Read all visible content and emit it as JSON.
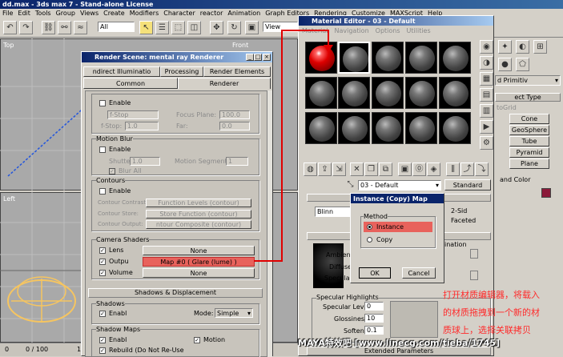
{
  "app": {
    "title": "dd.max - 3ds max 7 - Stand-alone License"
  },
  "menu": [
    "File",
    "Edit",
    "Tools",
    "Group",
    "Views",
    "Create",
    "Modifiers",
    "Character",
    "reactor",
    "Animation",
    "Graph Editors",
    "Rendering",
    "Customize",
    "MAXScript",
    "Help"
  ],
  "toolbar": {
    "selection_filter": "All",
    "ref_coord": "View"
  },
  "viewports": {
    "top": "Top",
    "front": "Front",
    "left": "Left"
  },
  "timeline": {
    "frame": "0 / 100",
    "ticks": [
      "0",
      "10"
    ]
  },
  "command_panel": {
    "category": "d Primitiv",
    "rollup_object_type": "ect Type",
    "autogrid": "toGrid",
    "buttons": [
      "Cone",
      "GeoSphere",
      "Tube",
      "Pyramid",
      "Plane"
    ],
    "name_color": "and Color"
  },
  "render_scene": {
    "title": "Render Scene: mental ray Renderer",
    "tabs_row1": [
      "ndirect Illuminatio",
      "Processing",
      "Render Elements"
    ],
    "tabs_row2": [
      "Common",
      "Renderer"
    ],
    "dof": {
      "enable": "Enable",
      "type": "f-Stop",
      "fstop_label": "f-Stop:",
      "fstop_value": "1.0",
      "focus_label": "Focus Plane:",
      "focus_value": "100.0",
      "far_label": "Far:",
      "far_value": "0.0"
    },
    "motion_blur": {
      "title": "Motion Blur",
      "enable": "Enable",
      "shutter_label": "Shutter:",
      "shutter_value": "1.0",
      "segments_label": "Motion Segments:",
      "segments_value": "1",
      "blur_all": "Blur All"
    },
    "contours": {
      "title": "Contours",
      "enable": "Enable",
      "contrast_label": "Contour Contrast:",
      "contrast_value": "Function Levels (contour)",
      "store_label": "Contour Store:",
      "store_value": "Store Function (contour)",
      "output_label": "Contour Output:",
      "output_value": "ntour Composite (contour)"
    },
    "camera_shaders": {
      "title": "Camera Shaders",
      "lens": "Lens",
      "output": "Outpu",
      "volume": "Volume",
      "lens_value": "None",
      "output_value": "Map #0   ( Glare (lume) )",
      "volume_value": "None"
    },
    "shadows_rollup": "Shadows & Displacement",
    "shadows": {
      "title": "Shadows",
      "enable": "Enabl",
      "mode_label": "Mode:",
      "mode_value": "Simple"
    },
    "shadow_maps": {
      "title": "Shadow Maps",
      "enable": "Enabl",
      "motion": "Motion",
      "rebuild": "Rebuild (Do Not Re-Use"
    }
  },
  "material_editor": {
    "title": "Material Editor - 03 - Default",
    "menu": [
      "Material",
      "Navigation",
      "Options",
      "Utilities"
    ],
    "material_name": "03 - Default",
    "material_type": "Standard",
    "shader": "Blinn",
    "two_sided": "2-Sid",
    "faceted": "Faceted",
    "ambient": "Ambient:",
    "diffuse": "Diffuse:",
    "specular": "Specular:",
    "spec_title": "Specular Highlights",
    "spec_level_label": "Specular Level:",
    "spec_level_value": "0",
    "glossiness_label": "Glossiness:",
    "glossiness_value": "10",
    "soften_label": "Soften:",
    "soften_value": "0.1",
    "self_illum": "ination",
    "extended_rollup": "Extended Parameters"
  },
  "instance_dialog": {
    "title": "Instance (Copy) Map",
    "method": "Method",
    "instance": "Instance",
    "copy": "Copy",
    "ok": "OK",
    "cancel": "Cancel"
  },
  "annotation": {
    "line1": "打开材质编辑器，将载入",
    "line2": "的材质拖拽到一个新的材",
    "line3": "质球上，选择关联拷贝"
  },
  "watermark": "MAYA特效吧 [www.linecg.com/tieba/1745]",
  "colors": {
    "highlight": "#e8625c",
    "title_blue": "#0a246a",
    "red_arrow": "#e00000"
  }
}
